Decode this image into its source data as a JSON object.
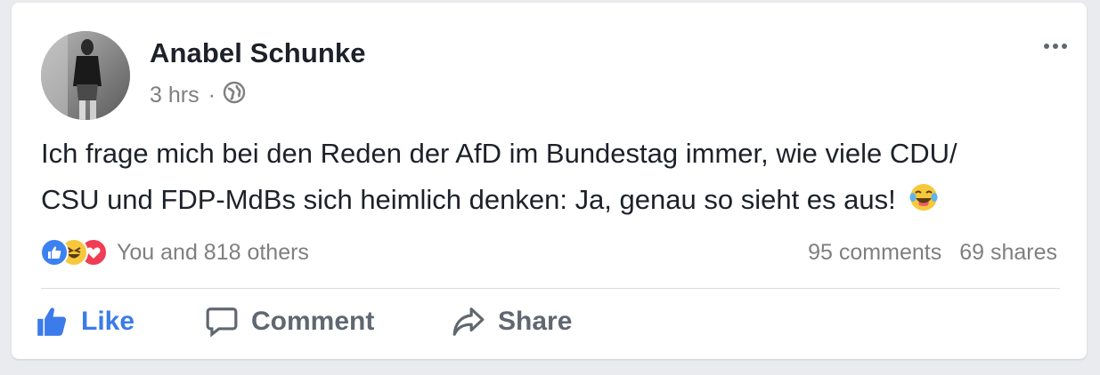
{
  "post": {
    "author": "Anabel Schunke",
    "time": "3 hrs",
    "separator": "·",
    "privacy_icon": "globe-icon",
    "text_line1": "Ich frage mich bei den Reden der AfD im Bundestag immer, wie viele CDU/",
    "text_line2": "CSU und FDP-MdBs sich heimlich denken: Ja, genau so sieht es aus!",
    "text_emoji": "tears-of-joy-emoji"
  },
  "reactions": {
    "icons": [
      "like-reaction-icon",
      "haha-reaction-icon",
      "love-reaction-icon"
    ],
    "summary": "You and 818 others"
  },
  "counts": {
    "comments": "95 comments",
    "shares": "69 shares"
  },
  "actions": {
    "like": "Like",
    "comment": "Comment",
    "share": "Share"
  },
  "colors": {
    "like_blue": "#3b7bea",
    "text": "#1d2129",
    "muted": "#7f7f7f"
  }
}
